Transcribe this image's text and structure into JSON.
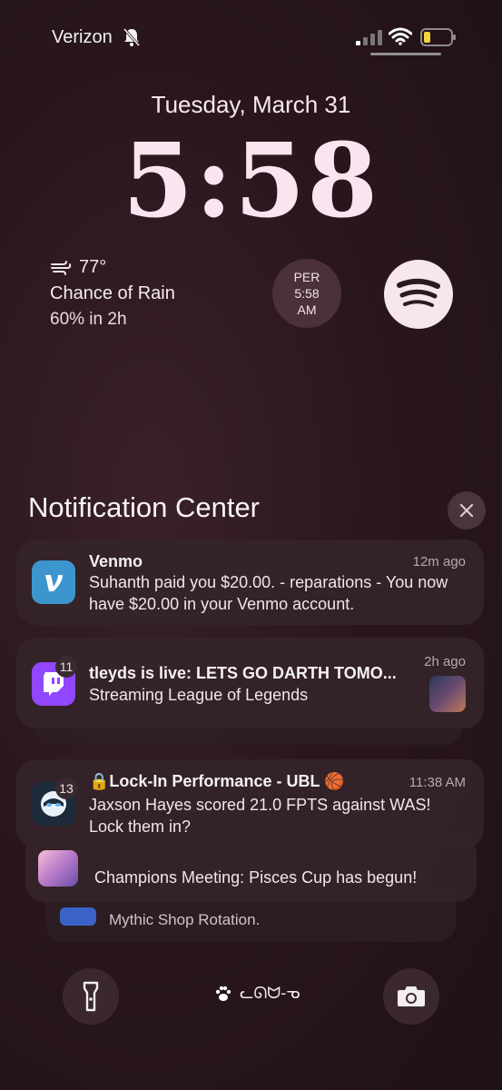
{
  "status": {
    "carrier": "Verizon"
  },
  "lock": {
    "date": "Tuesday, March 31",
    "time": "5:58"
  },
  "weather": {
    "temp": "77°",
    "condition": "Chance of Rain",
    "detail": "60% in 2h"
  },
  "per_widget": {
    "line1": "PER",
    "line2": "5:58",
    "line3": "AM"
  },
  "notification_center": {
    "title": "Notification Center"
  },
  "notifications": [
    {
      "app": "Venmo",
      "time": "12m ago",
      "body": "Suhanth paid you $20.00. - reparations - You now have $20.00 in your Venmo account.",
      "color": "#3d95ce"
    },
    {
      "app": "tleyds is live: LETS GO DARTH TOMO...",
      "time": "2h ago",
      "body": "Streaming League of Legends",
      "badge": "11",
      "color": "#9146ff"
    },
    {
      "app": "🔒Lock-In Performance - UBL 🏀",
      "time": "11:38 AM",
      "body": "Jaxson Hayes scored 21.0 FPTS against WAS! Lock them in?",
      "badge": "13",
      "color": "#1c2a3a"
    },
    {
      "body": "Champions Meeting: Pisces Cup has begun!"
    },
    {
      "body": "Mythic Shop Rotation."
    }
  ],
  "bottom": {
    "widget_label": "ᓚᘏᗢ-ᓀ"
  }
}
